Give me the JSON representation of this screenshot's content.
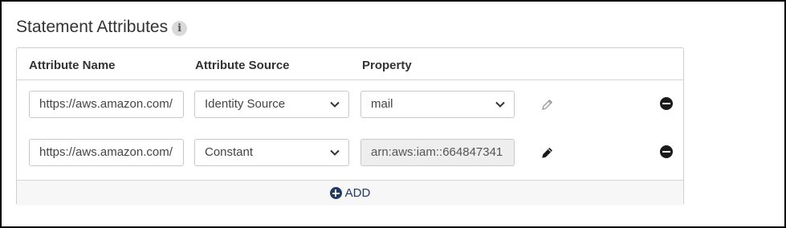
{
  "section": {
    "title": "Statement Attributes",
    "info_glyph": "i"
  },
  "columns": {
    "name": "Attribute Name",
    "source": "Attribute Source",
    "property": "Property"
  },
  "rows": [
    {
      "name": "https://aws.amazon.com/",
      "source": "Identity Source",
      "property": "mail",
      "property_disabled": false
    },
    {
      "name": "https://aws.amazon.com/",
      "source": "Constant",
      "property": "arn:aws:iam::664847341",
      "property_disabled": true
    }
  ],
  "add": {
    "label": "ADD"
  },
  "colors": {
    "accent": "#1f3b63",
    "border": "#cfcfcf",
    "disabled_bg": "#eeeeee"
  }
}
